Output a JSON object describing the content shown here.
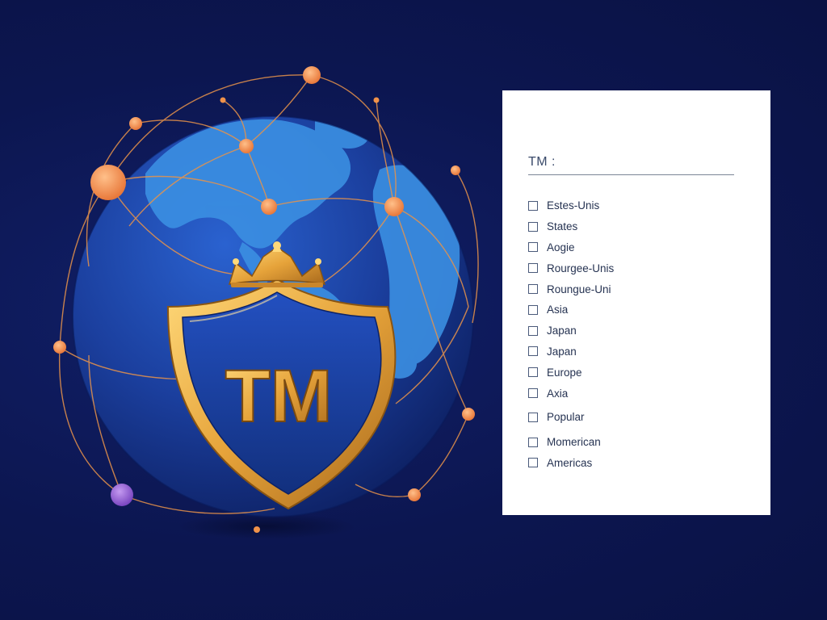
{
  "emblem": {
    "text": "TM"
  },
  "panel": {
    "title": "TM :",
    "options": [
      "Estes-Unis",
      "States",
      "Aogie",
      "Rourgee-Unis",
      "Roungue-Uni",
      "Asia",
      "Japan",
      "Japan",
      "Europe",
      "Axia",
      "Popular",
      "Momerican",
      "Americas"
    ]
  },
  "colors": {
    "background": "#0c1650",
    "globe": "#1d47b0",
    "land": "#3a8ee0",
    "gold": "#e6a83a",
    "node_orange": "#f0924a",
    "node_purple": "#8a5ac8",
    "panel": "#ffffff"
  },
  "icons": [
    "globe",
    "shield-emblem",
    "crown",
    "network-node",
    "checkbox"
  ]
}
